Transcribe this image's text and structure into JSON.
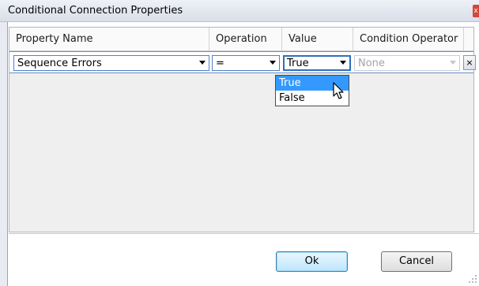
{
  "window": {
    "title": "Conditional Connection Properties",
    "close_glyph": "x"
  },
  "columns": [
    "Property Name",
    "Operation",
    "Value",
    "Condition Operator"
  ],
  "row": {
    "property_name": "Sequence Errors",
    "operation": "=",
    "value": "True",
    "condition_operator": "None",
    "remove_glyph": "×"
  },
  "value_dropdown": {
    "options": [
      "True",
      "False"
    ],
    "selected_index": 0
  },
  "buttons": {
    "ok": "Ok",
    "cancel": "Cancel"
  },
  "icons": {
    "close": "close-icon",
    "dropdown_arrow": "chevron-down-icon",
    "remove": "remove-row-icon",
    "cursor": "mouse-pointer-icon",
    "resize": "resize-grip-icon"
  },
  "colors": {
    "selection": "#3399ff",
    "row_border": "#6b90c3",
    "close_button": "#d0493c",
    "primary_button": "#bee6fd"
  }
}
